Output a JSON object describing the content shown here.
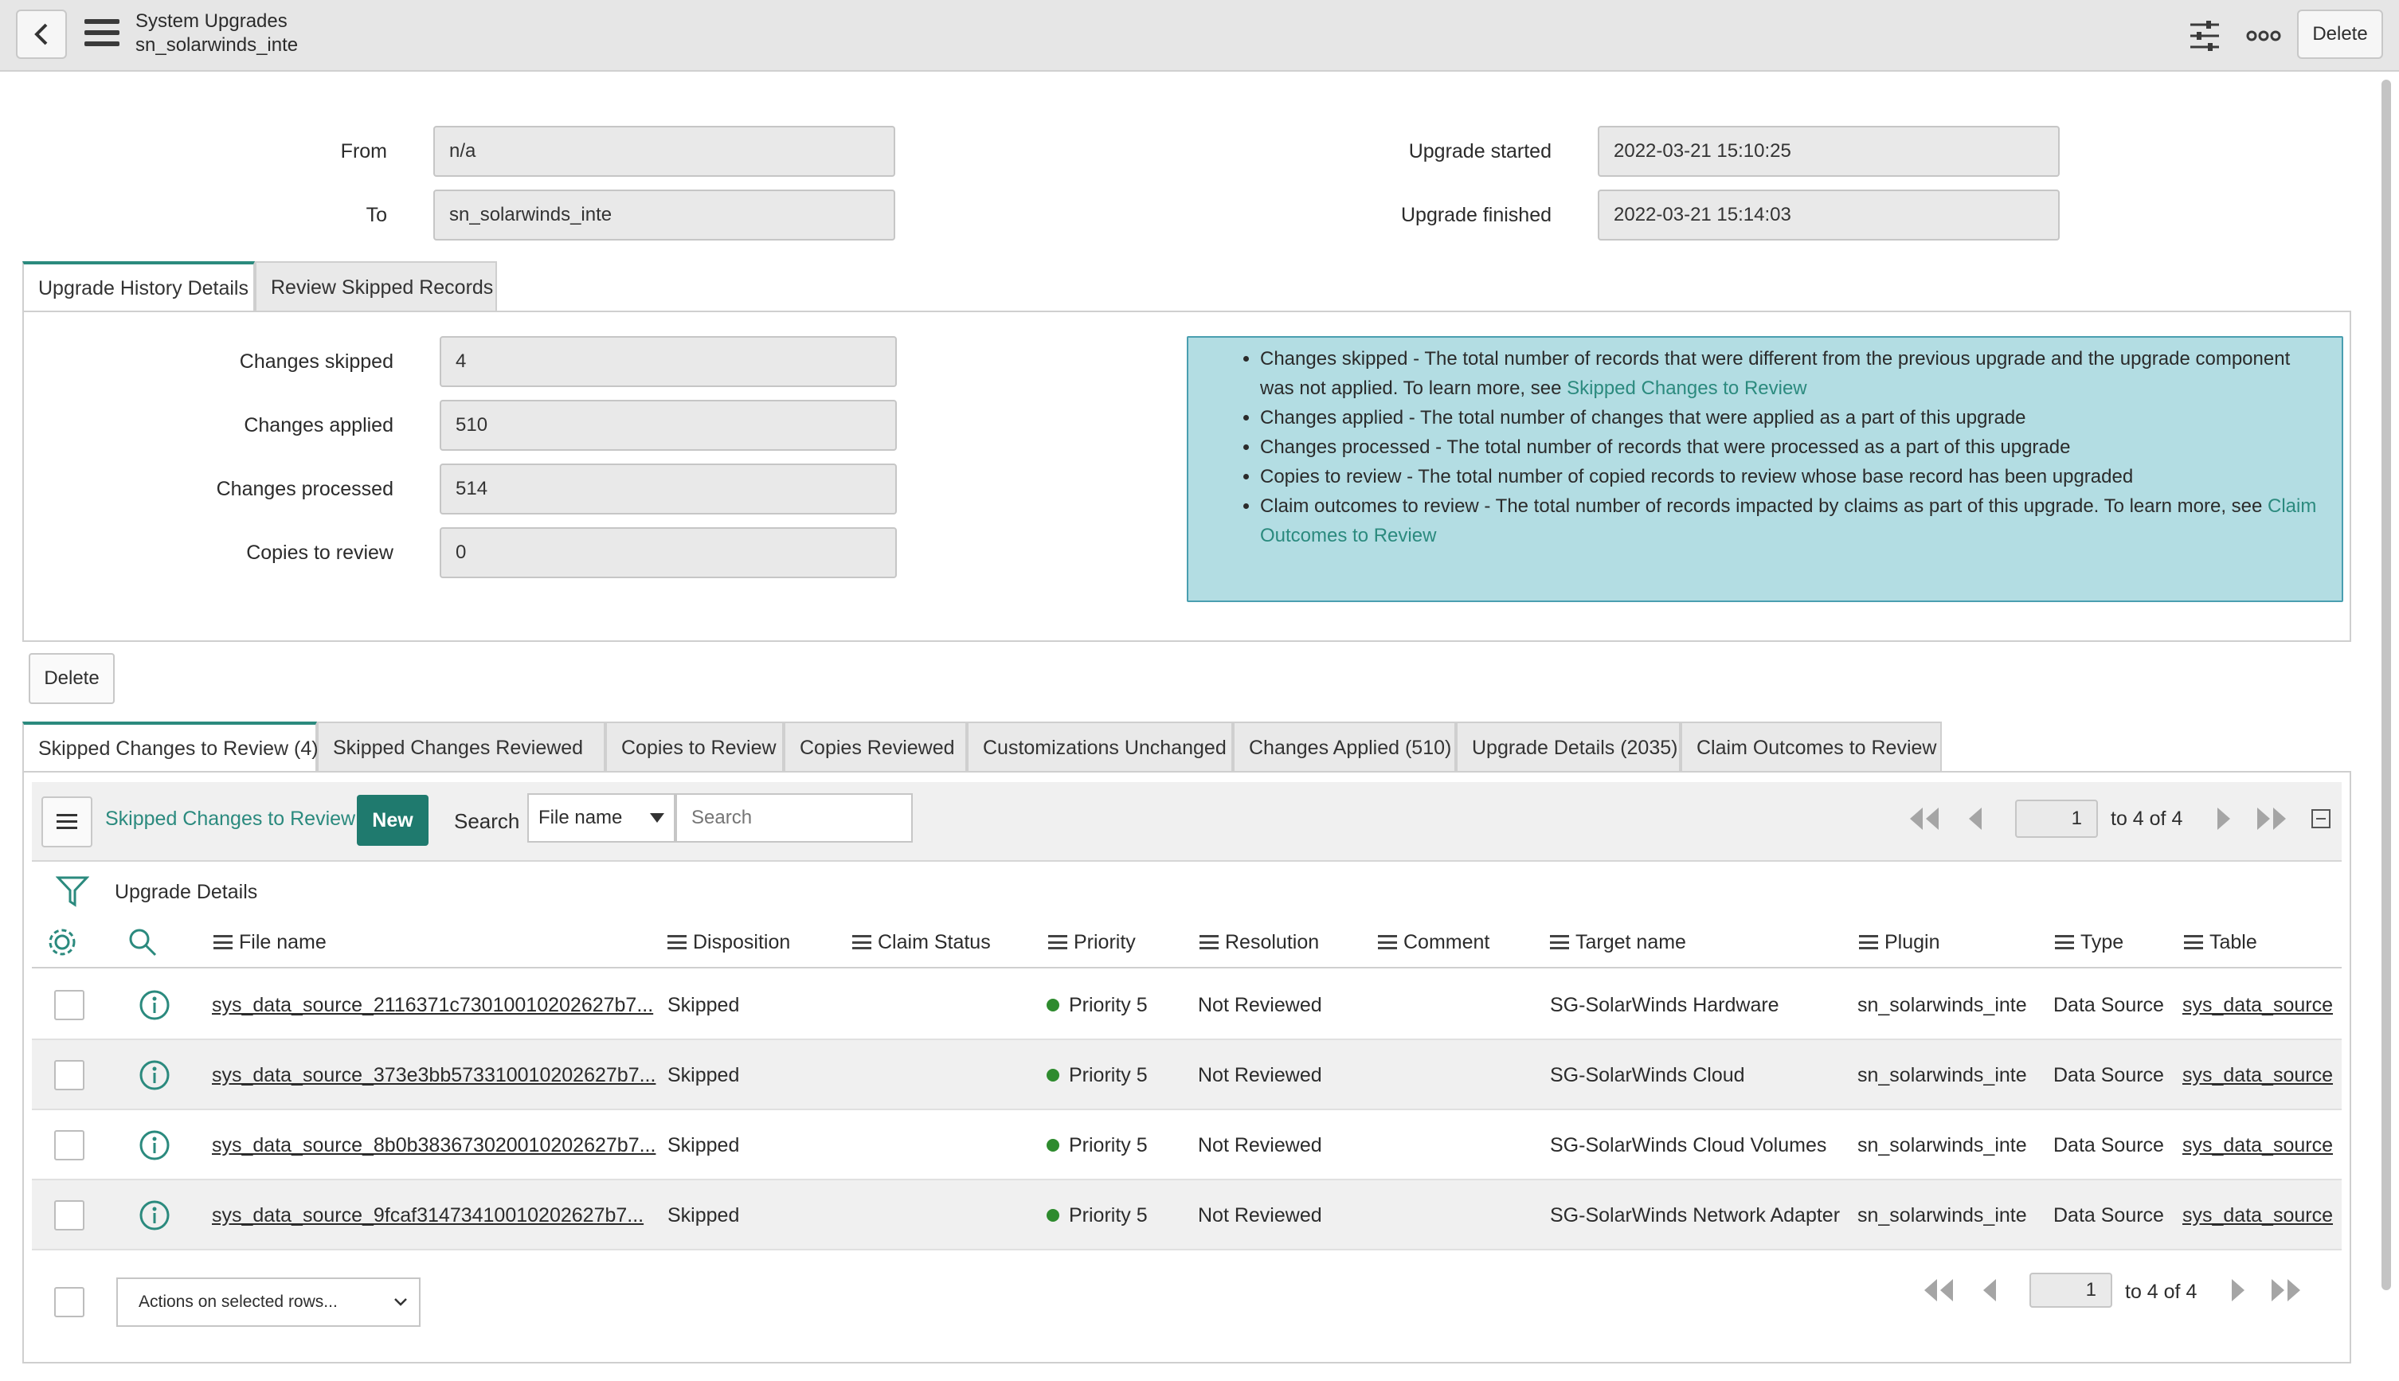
{
  "header": {
    "title": "System Upgrades",
    "subtitle": "sn_solarwinds_inte",
    "delete_label": "Delete"
  },
  "form": {
    "from_label": "From",
    "from_value": "n/a",
    "to_label": "To",
    "to_value": "sn_solarwinds_inte",
    "started_label": "Upgrade started",
    "started_value": "2022-03-21 15:10:25",
    "finished_label": "Upgrade finished",
    "finished_value": "2022-03-21 15:14:03"
  },
  "section_tabs": [
    "Upgrade History Details",
    "Review Skipped Records"
  ],
  "details": {
    "skipped_label": "Changes skipped",
    "skipped_value": "4",
    "applied_label": "Changes applied",
    "applied_value": "510",
    "processed_label": "Changes processed",
    "processed_value": "514",
    "copies_label": "Copies to review",
    "copies_value": "0"
  },
  "info": {
    "line1_text": "Changes skipped - The total number of records that were different from the previous upgrade and the upgrade component",
    "line1b_text": "was not applied. To learn more, see ",
    "line1_link": "Skipped Changes to Review",
    "line2": "Changes applied - The total number of changes that were applied as a part of this upgrade",
    "line3": "Changes processed - The total number of records that were processed as a part of this upgrade",
    "line4": "Copies to review - The total number of copied records to review whose base record has been upgraded",
    "line5_text": "Claim outcomes to review - The total number of records impacted by claims as part of this upgrade. To learn more, see ",
    "line5_link_a": "Claim",
    "line5_link_b": "Outcomes to Review"
  },
  "delete_button": "Delete",
  "list_tabs": [
    "Skipped Changes to Review (4)",
    "Skipped Changes Reviewed",
    "Copies to Review",
    "Copies  Reviewed",
    "Customizations Unchanged",
    "Changes Applied (510)",
    "Upgrade Details (2035)",
    "Claim Outcomes to Review"
  ],
  "toolbar": {
    "list_title": "Skipped Changes to Review",
    "new_label": "New",
    "search_label": "Search",
    "search_field": "File name",
    "search_placeholder": "Search",
    "page_value": "1",
    "page_text": "to 4 of 4"
  },
  "breadcrumb": "Upgrade Details",
  "columns": [
    "File name",
    "Disposition",
    "Claim Status",
    "Priority",
    "Resolution",
    "Comment",
    "Target name",
    "Plugin",
    "Type",
    "Table"
  ],
  "rows": [
    {
      "file": "sys_data_source_2116371c73010010202627b7...",
      "disposition": "Skipped",
      "claim": "",
      "priority": "Priority 5",
      "resolution": "Not Reviewed",
      "comment": "",
      "target": "SG-SolarWinds Hardware",
      "plugin": "sn_solarwinds_inte",
      "type": "Data Source",
      "table": "sys_data_source"
    },
    {
      "file": "sys_data_source_373e3bb573310010202627b7...",
      "disposition": "Skipped",
      "claim": "",
      "priority": "Priority 5",
      "resolution": "Not Reviewed",
      "comment": "",
      "target": "SG-SolarWinds Cloud",
      "plugin": "sn_solarwinds_inte",
      "type": "Data Source",
      "table": "sys_data_source"
    },
    {
      "file": "sys_data_source_8b0b383673020010202627b7...",
      "disposition": "Skipped",
      "claim": "",
      "priority": "Priority 5",
      "resolution": "Not Reviewed",
      "comment": "",
      "target": "SG-SolarWinds Cloud Volumes",
      "plugin": "sn_solarwinds_inte",
      "type": "Data Source",
      "table": "sys_data_source"
    },
    {
      "file": "sys_data_source_9fcaf31473410010202627b7...",
      "disposition": "Skipped",
      "claim": "",
      "priority": "Priority 5",
      "resolution": "Not Reviewed",
      "comment": "",
      "target": "SG-SolarWinds Network Adapter",
      "plugin": "sn_solarwinds_inte",
      "type": "Data Source",
      "table": "sys_data_source"
    }
  ],
  "footer": {
    "actions_label": "Actions on selected rows...",
    "page_value": "1",
    "page_text": "to 4 of 4"
  },
  "colors": {
    "accent": "#2b8a7e",
    "new_button": "#1f7a6e",
    "info_bg": "#b3dde3",
    "priority_dot": "#2e8b2e"
  }
}
